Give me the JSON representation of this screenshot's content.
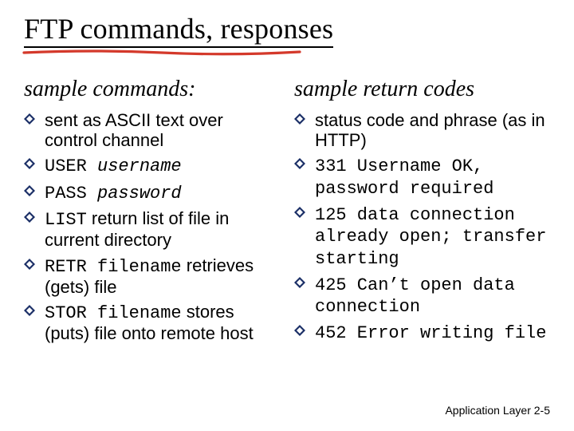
{
  "title": "FTP commands, responses",
  "left": {
    "heading": "sample commands:",
    "items": {
      "i0": {
        "a": "sent as ASCII text over control channel"
      },
      "i1": {
        "a": "USER",
        "b": " username"
      },
      "i2": {
        "a": "PASS",
        "b": " password"
      },
      "i3": {
        "a": "LIST",
        "b": " return list of file in current directory"
      },
      "i4": {
        "a": "RETR filename",
        "b": " retrieves (gets) file"
      },
      "i5": {
        "a": "STOR filename",
        "b": " stores (puts) file onto remote host"
      }
    }
  },
  "right": {
    "heading": "sample return codes",
    "items": {
      "r0": {
        "a": "status code and phrase (as in HTTP)"
      },
      "r1": {
        "a": "331 Username OK, password required"
      },
      "r2": {
        "a": "125 data connection already open; transfer starting"
      },
      "r3": {
        "a": "425 Can’t open data connection"
      },
      "r4": {
        "a": "452 Error writing file"
      }
    }
  },
  "footer": {
    "label": "Application Layer",
    "page": "2-5"
  }
}
